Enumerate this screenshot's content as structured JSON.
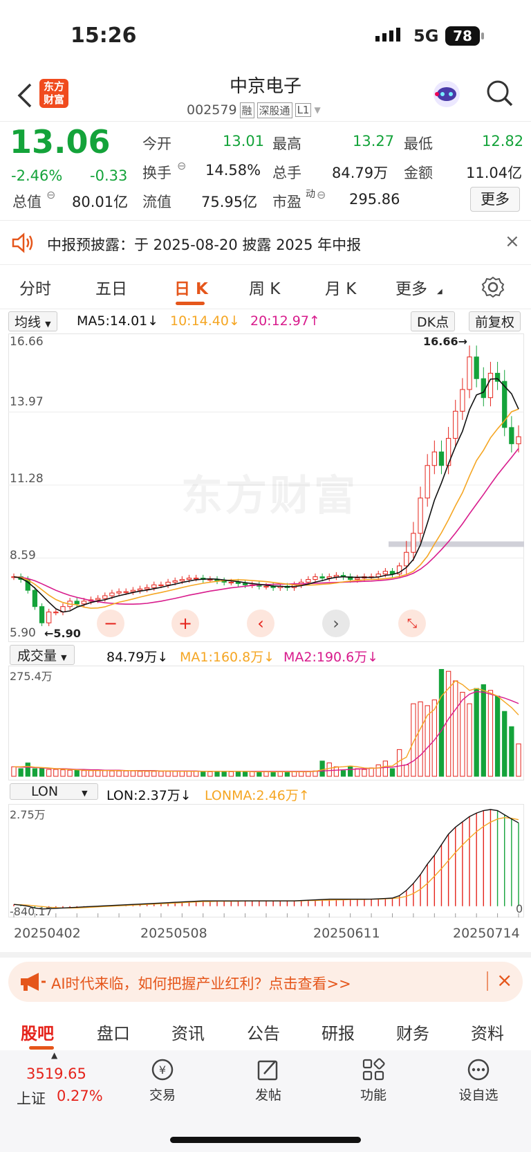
{
  "status_bar": {
    "time": "15:26",
    "network": "5G",
    "battery": "78"
  },
  "header": {
    "logo_line1": "东方",
    "logo_line2": "财富",
    "stock_name": "中京电子",
    "stock_code": "002579",
    "badges": [
      "融",
      "深股通",
      "L1"
    ]
  },
  "quote": {
    "price": "13.06",
    "change_pct": "-2.46%",
    "change": "-0.33",
    "open_label": "今开",
    "open": "13.01",
    "high_label": "最高",
    "high": "13.27",
    "low_label": "最低",
    "low": "12.82",
    "turnover_label": "换手",
    "turnover": "14.58%",
    "volume_label": "总手",
    "volume": "84.79万",
    "amount_label": "金额",
    "amount": "11.04亿",
    "mcap_label": "总值",
    "mcap": "80.01亿",
    "float_label": "流值",
    "float": "75.95亿",
    "pe_label": "市盈",
    "pe_sup": "动",
    "pe": "295.86",
    "more_label": "更多"
  },
  "notice": {
    "text": "中报预披露：于 2025-08-20 披露 2025 年中报"
  },
  "chart_tabs": [
    "分时",
    "五日",
    "日 K",
    "周 K",
    "月 K",
    "更多"
  ],
  "active_tab": "日 K",
  "ma_bar": {
    "selector": "均线",
    "ma5": "MA5:14.01↓",
    "ma10": "10:14.40↓",
    "ma20": "20:12.97↑",
    "dk": "DK点",
    "fq": "前复权"
  },
  "vol_bar": {
    "selector": "成交量",
    "v": "84.79万↓",
    "ma1": "MA1:160.8万↓",
    "ma2": "MA2:190.6万↓"
  },
  "lon_bar": {
    "selector": "LON",
    "lon": "LON:2.37万↓",
    "lonma": "LONMA:2.46万↑"
  },
  "watermark": "东方财富",
  "chart_data": {
    "type": "candlestick",
    "y_ticks": [
      "16.66",
      "13.97",
      "11.28",
      "8.59",
      "5.90"
    ],
    "ylim": [
      5.9,
      16.66
    ],
    "max_label": "16.66→",
    "min_label": "←5.90",
    "x_ticks": [
      "20250402",
      "20250508",
      "20250611",
      "20250714"
    ],
    "volume_top_label": "275.4万",
    "volume_ylim": [
      0,
      275.4
    ],
    "lon_top_label": "2.75万",
    "lon_bottom_label": "-840.17",
    "lon_right_label": "0",
    "closes": [
      7.9,
      7.8,
      7.4,
      6.8,
      6.2,
      6.6,
      6.6,
      6.8,
      7.0,
      6.9,
      7.0,
      7.05,
      7.1,
      7.2,
      7.3,
      7.35,
      7.35,
      7.4,
      7.45,
      7.5,
      7.6,
      7.6,
      7.7,
      7.75,
      7.8,
      7.85,
      7.85,
      7.8,
      7.8,
      7.75,
      7.7,
      7.7,
      7.65,
      7.6,
      7.6,
      7.55,
      7.55,
      7.5,
      7.55,
      7.5,
      7.6,
      7.7,
      7.8,
      7.9,
      7.85,
      7.9,
      7.95,
      7.9,
      7.8,
      7.85,
      7.9,
      7.9,
      8.0,
      8.1,
      8.0,
      8.3,
      8.8,
      9.5,
      10.8,
      12.0,
      12.5,
      12.0,
      13.0,
      14.0,
      14.8,
      16.0,
      15.2,
      14.5,
      15.4,
      15.1,
      13.4,
      12.8,
      13.06
    ],
    "ma5": [
      7.9,
      7.85,
      7.7,
      7.48,
      7.22,
      6.96,
      6.72,
      6.6,
      6.64,
      6.78,
      6.86,
      6.95,
      7.01,
      7.05,
      7.13,
      7.2,
      7.26,
      7.32,
      7.37,
      7.41,
      7.46,
      7.51,
      7.57,
      7.63,
      7.69,
      7.74,
      7.79,
      7.81,
      7.82,
      7.81,
      7.78,
      7.75,
      7.72,
      7.68,
      7.65,
      7.62,
      7.59,
      7.56,
      7.55,
      7.53,
      7.54,
      7.57,
      7.63,
      7.7,
      7.76,
      7.83,
      7.88,
      7.9,
      7.88,
      7.88,
      7.88,
      7.87,
      7.89,
      7.95,
      7.98,
      8.06,
      8.24,
      8.54,
      9.08,
      9.88,
      10.72,
      11.36,
      12.06,
      12.7,
      13.26,
      14.06,
      14.6,
      14.7,
      15.18,
      15.2,
      14.92,
      14.64,
      14.08
    ],
    "ma10": [
      7.9,
      7.87,
      7.78,
      7.62,
      7.42,
      7.22,
      7.06,
      6.95,
      6.89,
      6.87,
      6.78,
      6.74,
      6.75,
      6.79,
      6.88,
      6.96,
      7.02,
      7.08,
      7.15,
      7.21,
      7.27,
      7.32,
      7.38,
      7.44,
      7.5,
      7.56,
      7.61,
      7.66,
      7.7,
      7.73,
      7.76,
      7.78,
      7.79,
      7.78,
      7.76,
      7.74,
      7.72,
      7.69,
      7.66,
      7.63,
      7.6,
      7.59,
      7.59,
      7.6,
      7.62,
      7.64,
      7.67,
      7.71,
      7.74,
      7.76,
      7.79,
      7.8,
      7.81,
      7.83,
      7.86,
      7.91,
      7.98,
      8.1,
      8.34,
      8.66,
      9.1,
      9.52,
      10.0,
      10.52,
      11.0,
      11.61,
      12.18,
      12.56,
      13.02,
      13.35,
      13.65,
      13.98,
      14.08
    ],
    "ma20": [
      7.9,
      7.88,
      7.83,
      7.75,
      7.64,
      7.52,
      7.4,
      7.3,
      7.21,
      7.14,
      7.08,
      7.02,
      6.98,
      6.94,
      6.92,
      6.9,
      6.89,
      6.89,
      6.9,
      6.92,
      6.96,
      7.0,
      7.05,
      7.1,
      7.16,
      7.22,
      7.27,
      7.32,
      7.37,
      7.41,
      7.45,
      7.49,
      7.52,
      7.55,
      7.58,
      7.6,
      7.61,
      7.62,
      7.63,
      7.63,
      7.64,
      7.64,
      7.65,
      7.66,
      7.67,
      7.68,
      7.69,
      7.7,
      7.71,
      7.72,
      7.73,
      7.74,
      7.76,
      7.78,
      7.81,
      7.86,
      7.93,
      8.03,
      8.18,
      8.38,
      8.63,
      8.9,
      9.19,
      9.51,
      9.85,
      10.22,
      10.58,
      10.93,
      11.3,
      11.66,
      11.98,
      12.3,
      12.63
    ],
    "volumes": [
      25,
      20,
      35,
      20,
      20,
      18,
      18,
      17,
      16,
      16,
      15,
      15,
      15,
      15,
      14,
      14,
      14,
      14,
      13,
      13,
      13,
      13,
      13,
      13,
      13,
      13,
      13,
      13,
      12,
      12,
      12,
      12,
      12,
      12,
      12,
      12,
      12,
      12,
      12,
      12,
      12,
      12,
      12,
      14,
      40,
      35,
      25,
      15,
      25,
      20,
      18,
      22,
      30,
      40,
      20,
      70,
      30,
      190,
      195,
      185,
      200,
      280,
      275,
      250,
      220,
      190,
      230,
      240,
      225,
      210,
      170,
      130,
      85
    ],
    "vol_ma1": [
      25,
      25,
      26,
      24,
      23,
      22,
      20,
      19,
      18,
      17,
      16,
      15,
      15,
      15,
      15,
      15,
      15,
      15,
      14,
      14,
      14,
      14,
      14,
      13,
      13,
      13,
      13,
      13,
      13,
      13,
      13,
      13,
      13,
      13,
      12,
      12,
      12,
      12,
      12,
      12,
      12,
      12,
      12,
      13,
      17,
      21,
      24,
      25,
      27,
      25,
      22,
      21,
      22,
      26,
      27,
      40,
      50,
      90,
      125,
      160,
      175,
      210,
      230,
      250,
      240,
      225,
      230,
      225,
      218,
      210,
      195,
      180,
      160.8
    ],
    "vol_ma2": [
      25,
      24,
      24,
      23,
      22,
      21,
      20,
      20,
      19,
      18,
      18,
      17,
      17,
      16,
      16,
      16,
      15,
      15,
      15,
      15,
      15,
      14,
      14,
      14,
      14,
      14,
      14,
      13,
      13,
      13,
      13,
      13,
      13,
      13,
      13,
      13,
      13,
      13,
      13,
      13,
      13,
      13,
      13,
      13,
      14,
      15,
      16,
      17,
      18,
      19,
      20,
      21,
      22,
      23,
      24,
      27,
      30,
      40,
      55,
      75,
      95,
      120,
      150,
      175,
      200,
      215,
      222,
      220,
      215,
      210,
      205,
      198,
      190.6
    ],
    "lon": [
      0.05,
      0.03,
      0.0,
      -0.05,
      -0.08,
      -0.07,
      -0.06,
      -0.05,
      -0.04,
      -0.03,
      -0.02,
      -0.01,
      0.0,
      0.01,
      0.02,
      0.03,
      0.04,
      0.05,
      0.06,
      0.07,
      0.08,
      0.09,
      0.1,
      0.11,
      0.12,
      0.13,
      0.14,
      0.15,
      0.15,
      0.15,
      0.15,
      0.15,
      0.15,
      0.15,
      0.15,
      0.15,
      0.15,
      0.15,
      0.15,
      0.15,
      0.15,
      0.16,
      0.17,
      0.18,
      0.19,
      0.2,
      0.2,
      0.2,
      0.2,
      0.2,
      0.2,
      0.2,
      0.21,
      0.22,
      0.23,
      0.3,
      0.45,
      0.65,
      0.9,
      1.2,
      1.45,
      1.75,
      2.05,
      2.25,
      2.4,
      2.55,
      2.65,
      2.72,
      2.75,
      2.72,
      2.6,
      2.48,
      2.37
    ],
    "lonma": [
      0.05,
      0.04,
      0.03,
      0.01,
      -0.01,
      -0.03,
      -0.04,
      -0.05,
      -0.05,
      -0.05,
      -0.04,
      -0.03,
      -0.02,
      -0.01,
      0.0,
      0.01,
      0.02,
      0.03,
      0.04,
      0.05,
      0.06,
      0.07,
      0.08,
      0.09,
      0.1,
      0.11,
      0.12,
      0.13,
      0.13,
      0.14,
      0.14,
      0.14,
      0.14,
      0.15,
      0.15,
      0.15,
      0.15,
      0.15,
      0.15,
      0.15,
      0.15,
      0.15,
      0.16,
      0.16,
      0.17,
      0.17,
      0.18,
      0.18,
      0.19,
      0.19,
      0.19,
      0.2,
      0.2,
      0.21,
      0.22,
      0.24,
      0.28,
      0.36,
      0.48,
      0.65,
      0.85,
      1.07,
      1.3,
      1.53,
      1.74,
      1.94,
      2.12,
      2.27,
      2.39,
      2.48,
      2.52,
      2.5,
      2.46
    ]
  },
  "chart_controls": [
    "zoom-out",
    "zoom-in",
    "left",
    "right",
    "expand"
  ],
  "ad_banner": {
    "text": "AI时代来临，如何把握产业红利？点击查看>>"
  },
  "bottom_tabs": [
    "股吧",
    "盘口",
    "资讯",
    "公告",
    "研报",
    "财务",
    "资料"
  ],
  "active_bottom": "股吧",
  "footer": {
    "index_value": "3519.65",
    "index_name": "上证",
    "index_change": "0.27%",
    "items": [
      {
        "label": "交易"
      },
      {
        "label": "发帖"
      },
      {
        "label": "功能"
      },
      {
        "label": "设自选"
      }
    ]
  }
}
